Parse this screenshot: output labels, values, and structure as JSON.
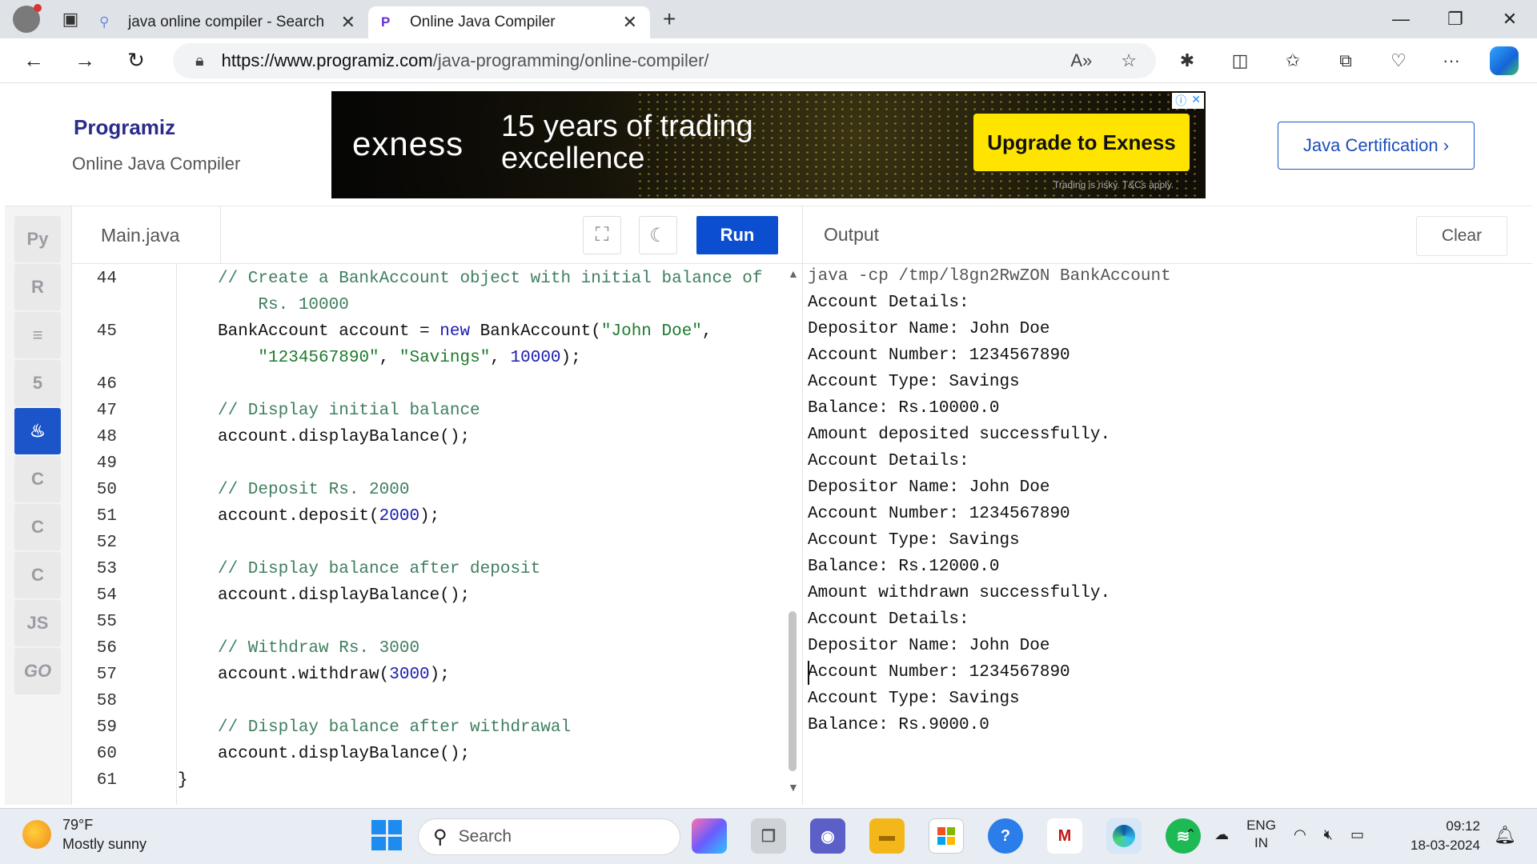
{
  "browser": {
    "tabs": [
      {
        "label": "java online compiler - Search",
        "icon": "search-icon"
      },
      {
        "label": "Online Java Compiler",
        "icon": "programiz-icon"
      }
    ],
    "url_domain": "https://www.programiz.com",
    "url_path": "/java-programming/online-compiler/"
  },
  "site": {
    "logo": "Programiz",
    "subtitle": "Online Java Compiler",
    "certification_button": "Java Certification ›"
  },
  "ad": {
    "brand": "exness",
    "headline": "15 years of trading excellence",
    "cta": "Upgrade to Exness",
    "disclaimer": "Trading is risky. T&Cs apply."
  },
  "languages": [
    {
      "name": "python",
      "label": "Py"
    },
    {
      "name": "r",
      "label": "R"
    },
    {
      "name": "sql",
      "label": "≡"
    },
    {
      "name": "html5",
      "label": "5"
    },
    {
      "name": "java",
      "label": "♨"
    },
    {
      "name": "c",
      "label": "C"
    },
    {
      "name": "cpp",
      "label": "C"
    },
    {
      "name": "csharp",
      "label": "C"
    },
    {
      "name": "javascript",
      "label": "JS"
    },
    {
      "name": "go",
      "label": "GO"
    }
  ],
  "editor": {
    "file_tab": "Main.java",
    "run_label": "Run",
    "lines": [
      {
        "num": "44",
        "text": "// Create a BankAccount object with initial balance of"
      },
      {
        "num": "",
        "text": "    Rs. 10000"
      },
      {
        "num": "45",
        "text": "BankAccount account = new BankAccount(\"John Doe\","
      },
      {
        "num": "",
        "text": "    \"1234567890\", \"Savings\", 10000);"
      },
      {
        "num": "46",
        "text": ""
      },
      {
        "num": "47",
        "text": "// Display initial balance"
      },
      {
        "num": "48",
        "text": "account.displayBalance();"
      },
      {
        "num": "49",
        "text": ""
      },
      {
        "num": "50",
        "text": "// Deposit Rs. 2000"
      },
      {
        "num": "51",
        "text": "account.deposit(2000);"
      },
      {
        "num": "52",
        "text": ""
      },
      {
        "num": "53",
        "text": "// Display balance after deposit"
      },
      {
        "num": "54",
        "text": "account.displayBalance();"
      },
      {
        "num": "55",
        "text": ""
      },
      {
        "num": "56",
        "text": "// Withdraw Rs. 3000"
      },
      {
        "num": "57",
        "text": "account.withdraw(3000);"
      },
      {
        "num": "58",
        "text": ""
      },
      {
        "num": "59",
        "text": "// Display balance after withdrawal"
      },
      {
        "num": "60",
        "text": "account.displayBalance();"
      },
      {
        "num": "61",
        "text": "}"
      }
    ]
  },
  "output": {
    "title": "Output",
    "clear_label": "Clear",
    "lines": [
      "java -cp /tmp/l8gn2RwZON BankAccount",
      "Account Details:",
      "Depositor Name: John Doe",
      "Account Number: 1234567890",
      "Account Type: Savings",
      "Balance: Rs.10000.0",
      "Amount deposited successfully.",
      "Account Details:",
      "Depositor Name: John Doe",
      "Account Number: 1234567890",
      "Account Type: Savings",
      "Balance: Rs.12000.0",
      "Amount withdrawn successfully.",
      "Account Details:",
      "Depositor Name: John Doe",
      "Account Number: 1234567890",
      "Account Type: Savings",
      "Balance: Rs.9000.0"
    ]
  },
  "taskbar": {
    "temperature": "79°F",
    "weather": "Mostly sunny",
    "search_placeholder": "Search",
    "lang_top": "ENG",
    "lang_bottom": "IN",
    "time": "09:12",
    "date": "18-03-2024"
  }
}
